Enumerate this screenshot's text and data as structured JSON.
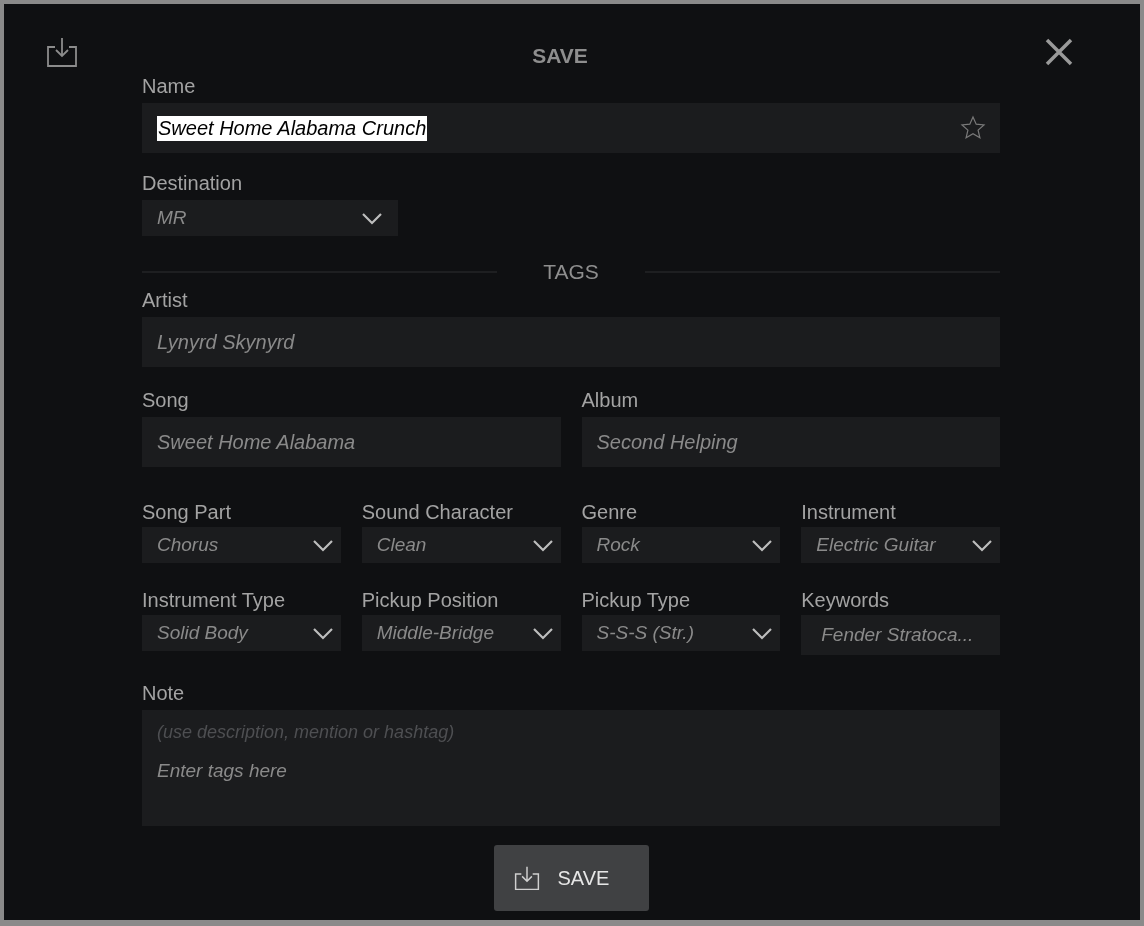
{
  "dialog": {
    "title": "SAVE"
  },
  "name": {
    "label": "Name",
    "value": "Sweet Home Alabama Crunch",
    "text_selected": true,
    "favorite": false
  },
  "destination": {
    "label": "Destination",
    "value": "MR"
  },
  "tags_heading": "TAGS",
  "artist": {
    "label": "Artist",
    "value": "Lynyrd Skynyrd"
  },
  "text_fields": [
    {
      "label": "Song",
      "value": "Sweet Home Alabama"
    },
    {
      "label": "Album",
      "value": "Second Helping"
    }
  ],
  "tag_fields": [
    {
      "kind": "dropdown",
      "label": "Song Part",
      "value": "Chorus"
    },
    {
      "kind": "dropdown",
      "label": "Sound Character",
      "value": "Clean"
    },
    {
      "kind": "dropdown",
      "label": "Genre",
      "value": "Rock"
    },
    {
      "kind": "dropdown",
      "label": "Instrument",
      "value": "Electric Guitar"
    },
    {
      "kind": "dropdown",
      "label": "Instrument Type",
      "value": "Solid Body"
    },
    {
      "kind": "dropdown",
      "label": "Pickup Position",
      "value": "Middle-Bridge"
    },
    {
      "kind": "dropdown",
      "label": "Pickup Type",
      "value": "S-S-S (Str.)"
    },
    {
      "kind": "text",
      "label": "Keywords",
      "value": "Fender Stratoca..."
    }
  ],
  "note": {
    "label": "Note",
    "hint": "(use description, mention or hashtag)",
    "placeholder": "Enter tags here"
  },
  "save_button": {
    "label": "SAVE"
  }
}
